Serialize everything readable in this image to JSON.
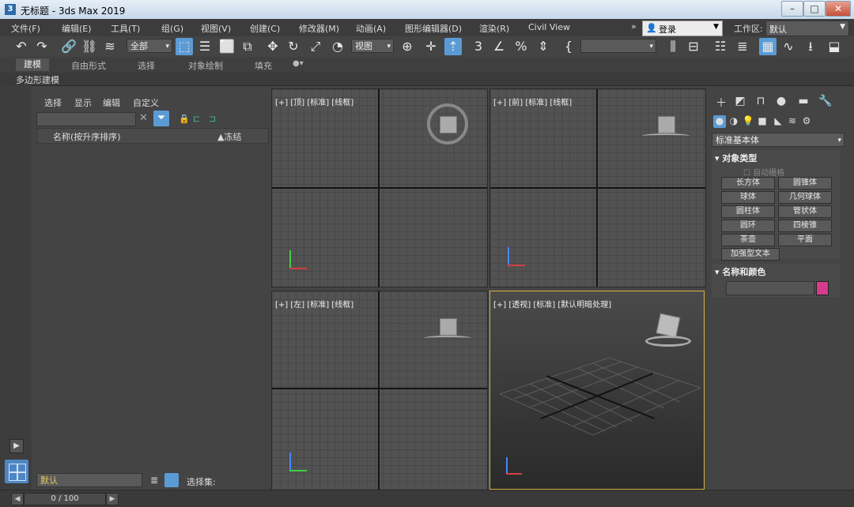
{
  "title_bar": {
    "app_icon": "3",
    "title": "无标题 - 3ds Max 2019"
  },
  "menu": {
    "items": [
      "文件(F)",
      "编辑(E)",
      "工具(T)",
      "组(G)",
      "视图(V)",
      "创建(C)",
      "修改器(M)",
      "动画(A)",
      "图形编辑器(D)",
      "渲染(R)",
      "Civil View"
    ],
    "overflow": "»",
    "login": "登录",
    "workspace_label": "工作区:",
    "workspace_value": "默认"
  },
  "toolbar": {
    "filter_value": "全部",
    "view_value": "视图"
  },
  "ribbon": {
    "tabs": [
      "建模",
      "自由形式",
      "选择",
      "对象绘制",
      "填充"
    ],
    "sub_label": "多边形建模"
  },
  "scene_explorer": {
    "menu": [
      "选择",
      "显示",
      "编辑",
      "自定义"
    ],
    "col_name": "名称(按升序排序)",
    "col_frozen": "▲冻结"
  },
  "viewports": {
    "top": "[+] [顶] [标准] [线框]",
    "front": "[+] [前] [标准] [线框]",
    "left": "[+] [左] [标准] [线框]",
    "persp": "[+] [透视] [标准] [默认明暗处理]"
  },
  "command_panel": {
    "category": "标准基本体",
    "object_type_header": "对象类型",
    "autogrid": "自动栅格",
    "buttons": [
      "长方体",
      "圆锥体",
      "球体",
      "几何球体",
      "圆柱体",
      "管状体",
      "圆环",
      "四棱锥",
      "茶壶",
      "平面",
      "加强型文本"
    ],
    "name_color_header": "名称和颜色",
    "color": "#d63c8c"
  },
  "bottom": {
    "layer": "默认",
    "selection_set": "选择集:",
    "frame": "0 / 100"
  }
}
